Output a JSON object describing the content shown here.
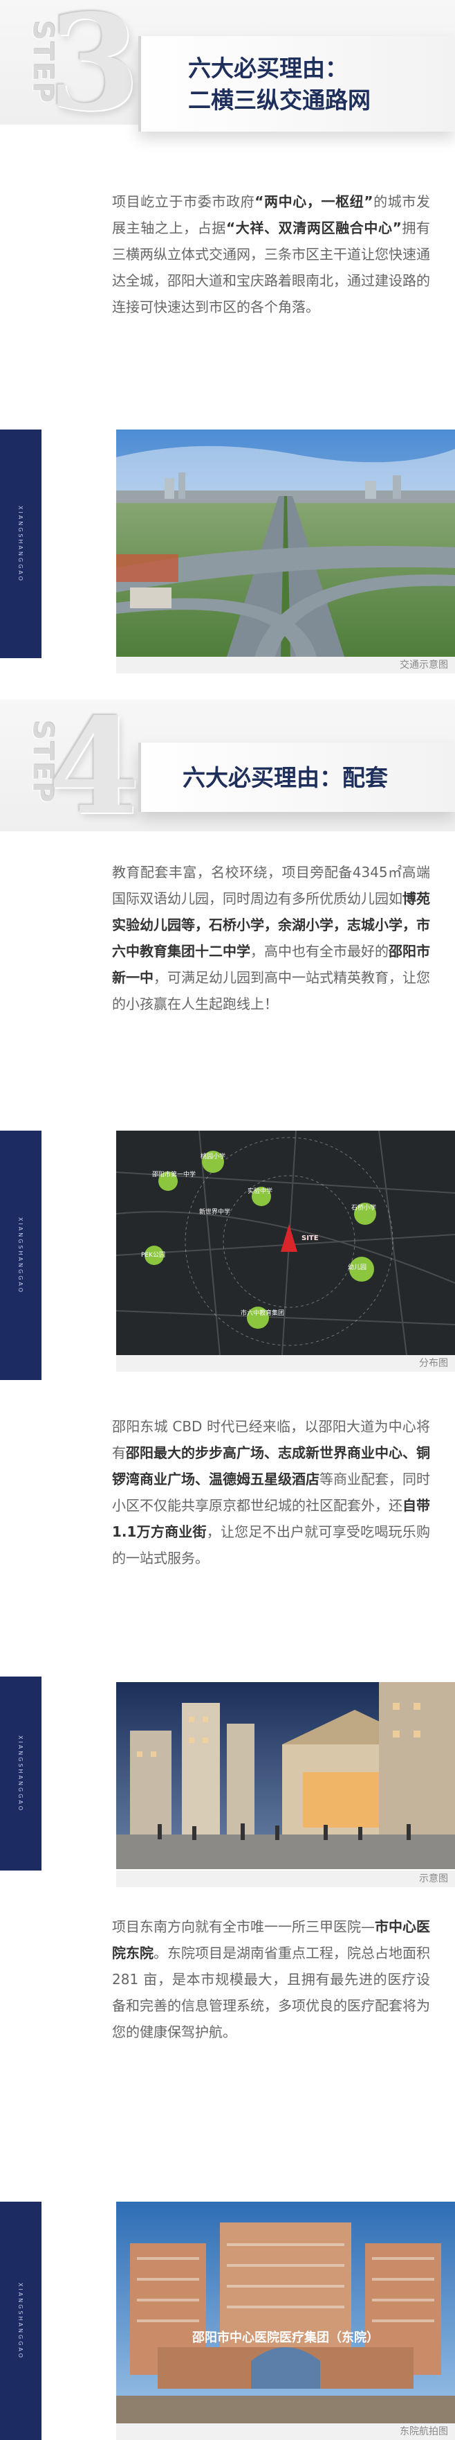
{
  "step3": {
    "word": "STEP",
    "number": "3",
    "title_line1": "六大必买理由：",
    "title_line2": "二横三纵交通路网"
  },
  "p1": {
    "a": "项目屹立于市委市政府",
    "b": "“两中心，一枢纽”",
    "c": "的城市发展主轴之上，占据",
    "d": "“大祥、双清两区融合中心”",
    "e": "拥有三横两纵立体式交通网，三条市区主干道让您快速通达全城，邵阳大道和宝庆路着眼南北，通过建设路的连接可快速达到市区的各个角落。"
  },
  "side_label": "XIANGSHANGGAO",
  "captions": {
    "traffic": "交通示意图",
    "distribution": "分布图",
    "plaza": "示意图",
    "hospital": "东院航拍图"
  },
  "step4": {
    "word": "STEP",
    "number": "4",
    "title": "六大必买理由：配套"
  },
  "p2": {
    "a": "教育配套丰富，名校环绕，项目旁配备4345㎡高端国际双语幼儿园，同时周边有多所优质幼儿园如",
    "b": "博苑实验幼儿园等，石桥小学，余湖小学，志城小学，市六中教育集团十二中学",
    "c": "，高中也有全市最好的",
    "d": "邵阳市新一中",
    "e": "，可满足幼儿园到高中一站式精英教育，让您的小孩赢在人生起跑线上！"
  },
  "map_labels": {
    "l1": "邵阳市第一中学",
    "l2": "桃园小学",
    "l3": "实验中学",
    "l4": "石桥小学",
    "l5": "PEK公园",
    "l6": "SITE",
    "l7": "幼儿园",
    "l8": "市六中教育集团",
    "l9": "新世界中学"
  },
  "p3": {
    "a": "邵阳东城 CBD 时代已经来临，以邵阳大道为中心将有",
    "b": "邵阳最大的步步高广场、志成新世界商业中心、铜锣湾商业广场、温德姆五星级酒店",
    "c": "等商业配套，同时小区不仅能共享原京都世纪城的社区配套外，还",
    "d": "自带1.1万方商业街",
    "e": "，让您足不出户就可享受吃喝玩乐购的一站式服务。"
  },
  "p4": {
    "a": "项目东南方向就有全市唯一一所三甲医院—",
    "b": "市中心医院东院",
    "c": "。东院项目是湖南省重点工程，院总占地面积 281 亩，是本市规模最大，且拥有最先进的医疗设备和完善的信息管理系统，多项优良的医疗配套将为您的健康保驾护航。"
  },
  "hospital_sign": "邵阳市中心医院医疗集团（东院）",
  "colors": {
    "navy": "#1d2b63",
    "title": "#1f2f5c"
  }
}
